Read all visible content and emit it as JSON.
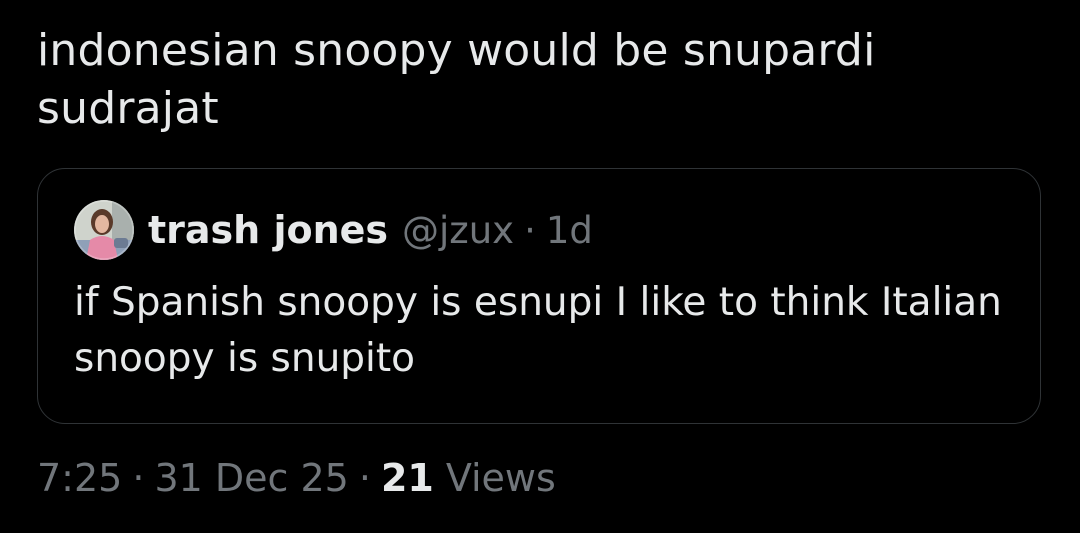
{
  "tweet": {
    "text": "indonesian snoopy would be snupardi sudrajat"
  },
  "quote": {
    "author_name": "trash jones",
    "author_handle": "@jzux",
    "separator": "·",
    "time": "1d",
    "avatar_icon": "user-avatar-photo",
    "text": "if Spanish snoopy is esnupi I like to think Italian snoopy is snupito"
  },
  "meta": {
    "time": "7:25",
    "separator": "·",
    "date": "31 Dec 25",
    "views_count": "21",
    "views_label": "Views"
  },
  "colors": {
    "background": "#000000",
    "primary_text": "#e7e9ea",
    "secondary_text": "#71767b",
    "border": "#2f3336"
  }
}
